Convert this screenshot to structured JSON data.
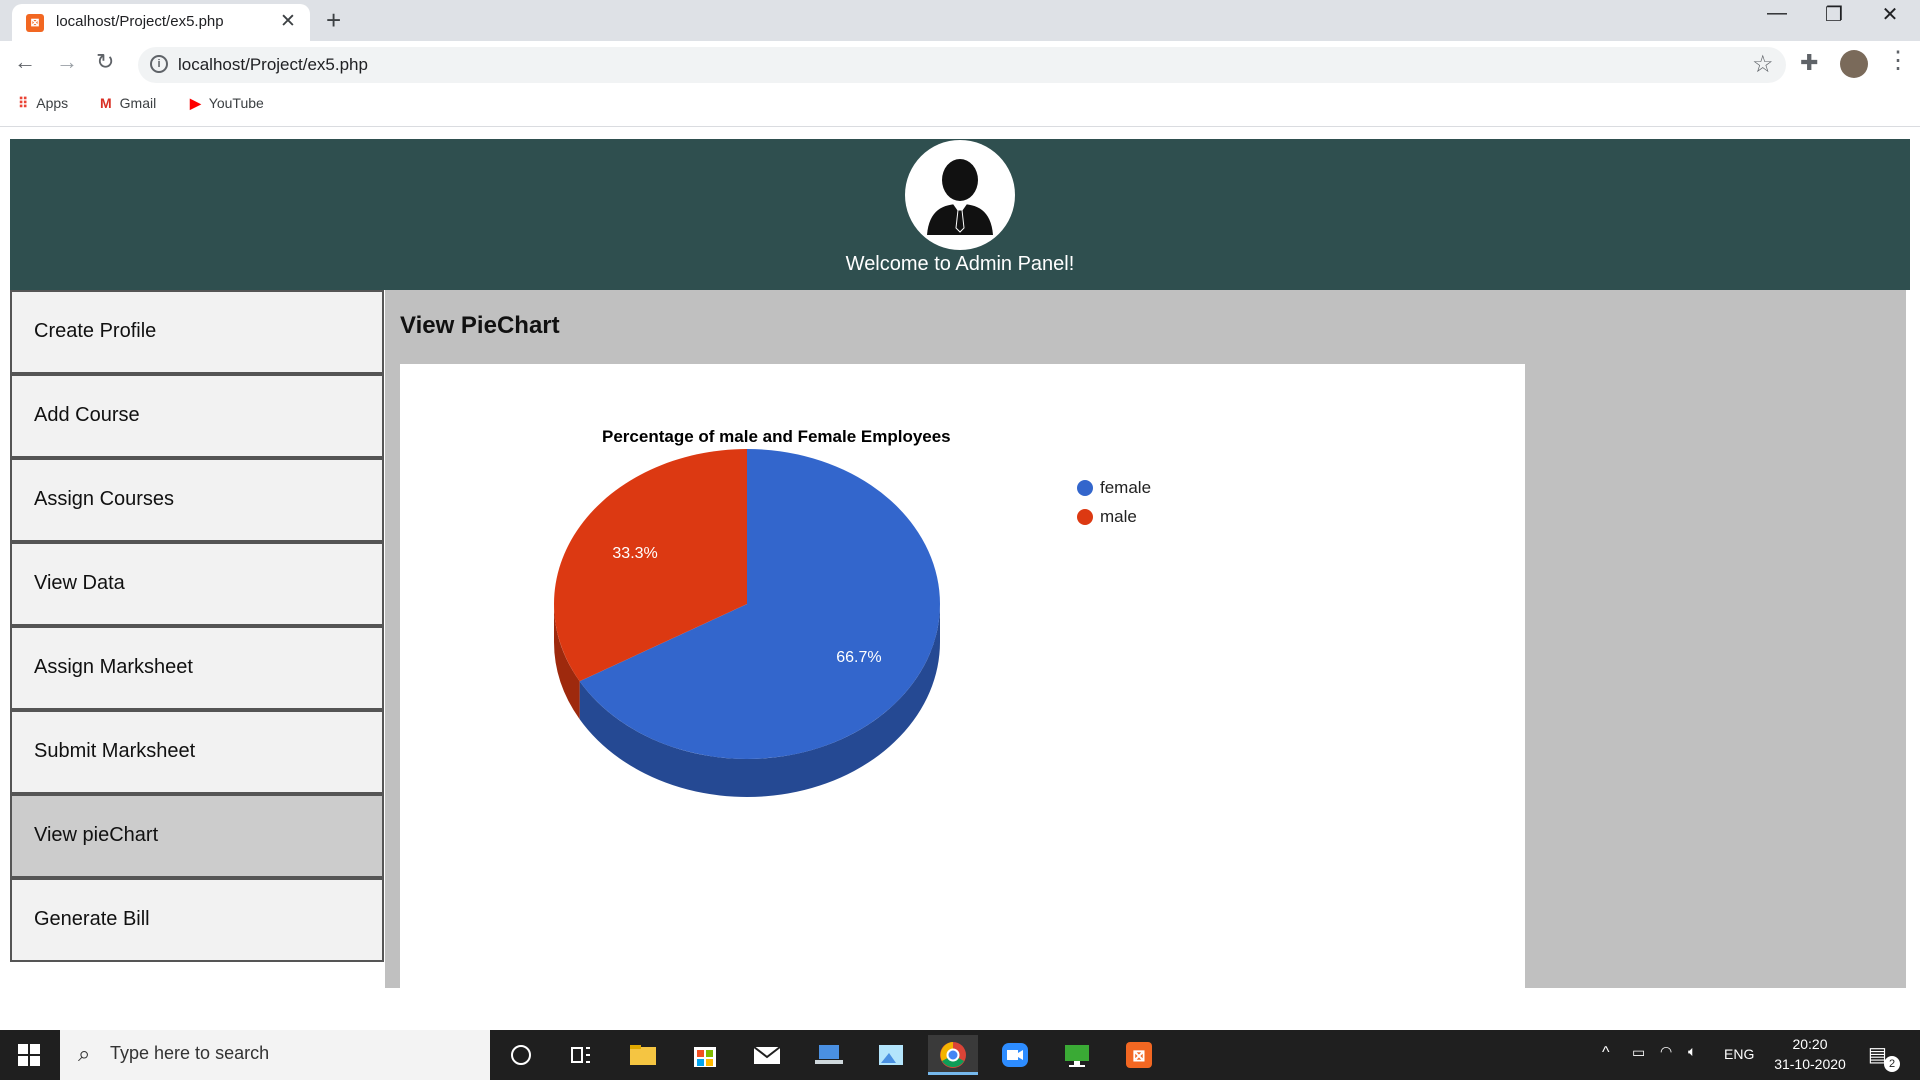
{
  "browser": {
    "tab_title": "localhost/Project/ex5.php",
    "url": "localhost/Project/ex5.php",
    "bookmarks": [
      "Apps",
      "Gmail",
      "YouTube"
    ]
  },
  "header": {
    "welcome": "Welcome to Admin Panel!"
  },
  "sidebar": {
    "items": [
      {
        "label": "Create Profile"
      },
      {
        "label": "Add Course"
      },
      {
        "label": "Assign Courses"
      },
      {
        "label": "View Data"
      },
      {
        "label": "Assign Marksheet"
      },
      {
        "label": "Submit Marksheet"
      },
      {
        "label": "View pieChart"
      },
      {
        "label": "Generate Bill"
      }
    ],
    "active_index": 6
  },
  "main": {
    "title": "View PieChart"
  },
  "chart_data": {
    "type": "pie",
    "title": "Percentage of male and Female Employees",
    "categories": [
      "female",
      "male"
    ],
    "values": [
      66.7,
      33.3
    ],
    "labels": [
      "66.7%",
      "33.3%"
    ],
    "colors": [
      "#3366cc",
      "#dc3912"
    ],
    "legend_position": "right",
    "is3D": true
  },
  "taskbar": {
    "search_placeholder": "Type here to search",
    "language": "ENG",
    "time": "20:20",
    "date": "31-10-2020",
    "notification_count": "2"
  }
}
